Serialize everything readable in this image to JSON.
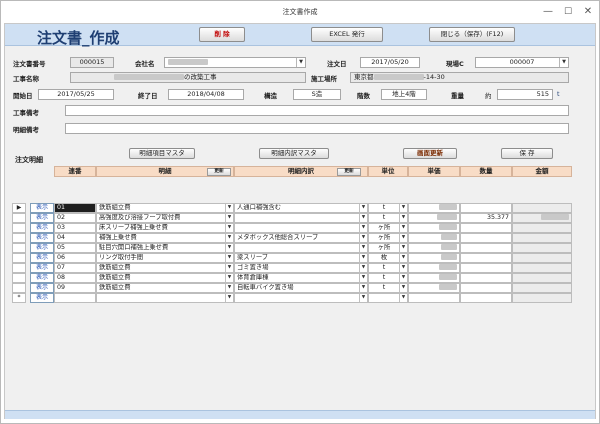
{
  "window": {
    "title": "注文書作成",
    "minimize": "—",
    "maximize": "☐",
    "close": "✕"
  },
  "header": {
    "form_title": "注文書_作成",
    "delete_label": "削 除",
    "excel_label": "EXCEL 発行",
    "close_save_label": "閉じる（保存）(F12)"
  },
  "order": {
    "number_label": "注文書番号",
    "number": "000015",
    "company_label": "会社名",
    "company_suffix": "",
    "date_label": "注文日",
    "date": "2017/05/20",
    "site_label": "現場C",
    "site_code": "000007",
    "work_name_label": "工事名称",
    "work_name_suffix": "の改築工事",
    "work_place_label": "施工場所",
    "work_place_prefix": "東京都",
    "work_place_suffix": "-14-30",
    "start_label": "開始日",
    "start": "2017/05/25",
    "end_label": "終了日",
    "end": "2018/04/08",
    "structure_label": "構造",
    "structure": "S造",
    "floors_label": "階数",
    "floors": "地上4階",
    "weight_label": "重量",
    "weight_approx": "約",
    "weight": "515",
    "weight_unit": "t",
    "work_note_label": "工事備考",
    "detail_note_label": "明細備考"
  },
  "details": {
    "section_label": "注文明細",
    "item_master_label": "明細項目マスタ",
    "breakdown_master_label": "明細内訳マスタ",
    "refresh_label": "画面更新",
    "save_label": "保 存",
    "columns": {
      "seq": "連番",
      "item": "明細",
      "breakdown": "明細内訳",
      "unit": "単位",
      "price": "単価",
      "qty": "数量",
      "amount": "金額"
    },
    "update_label": "更新",
    "show_label": "表示",
    "rows": [
      {
        "marker": "▶",
        "seq": "01",
        "item": "鉄筋組立費",
        "breakdown": "人通口補強含む",
        "unit": "t",
        "qty": ""
      },
      {
        "marker": "",
        "seq": "02",
        "item": "高強度及び溶接フープ取付費",
        "breakdown": "",
        "unit": "t",
        "qty": "35.377"
      },
      {
        "marker": "",
        "seq": "03",
        "item": "床スリーブ補強上乗せ費",
        "breakdown": "",
        "unit": "ヶ所",
        "qty": ""
      },
      {
        "marker": "",
        "seq": "04",
        "item": "補強上乗せ費",
        "breakdown": "メタボックス他総合スリーブ",
        "unit": "ヶ所",
        "qty": ""
      },
      {
        "marker": "",
        "seq": "05",
        "item": "駐目穴開口補強上乗せ費",
        "breakdown": "",
        "unit": "ヶ所",
        "qty": ""
      },
      {
        "marker": "",
        "seq": "06",
        "item": "リング取付手間",
        "breakdown": "梁スリーブ",
        "unit": "枚",
        "qty": ""
      },
      {
        "marker": "",
        "seq": "07",
        "item": "鉄筋組立費",
        "breakdown": "ゴミ置き場",
        "unit": "t",
        "qty": ""
      },
      {
        "marker": "",
        "seq": "08",
        "item": "鉄筋組立費",
        "breakdown": "体育倉庫棟",
        "unit": "t",
        "qty": ""
      },
      {
        "marker": "",
        "seq": "09",
        "item": "鉄筋組立費",
        "breakdown": "自転車バイク置き場",
        "unit": "t",
        "qty": ""
      },
      {
        "marker": "*",
        "seq": "",
        "item": "",
        "breakdown": "",
        "unit": "",
        "qty": ""
      }
    ]
  }
}
